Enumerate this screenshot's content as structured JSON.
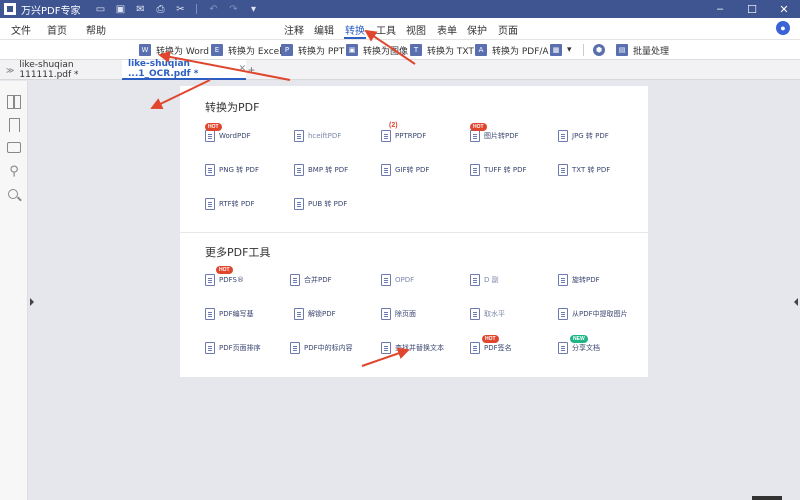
{
  "app": {
    "title": "万兴PDF专家"
  },
  "window_controls": [
    "–",
    "☐",
    "✕"
  ],
  "menu": {
    "left": [
      "文件",
      "首页",
      "帮助"
    ],
    "center": [
      "注释",
      "编辑",
      "转换",
      "工具",
      "视图",
      "表单",
      "保护",
      "页面"
    ],
    "active": "转换"
  },
  "toolbar": {
    "items": [
      {
        "label": "转换为 Word",
        "icon": "W"
      },
      {
        "label": "转换为 Excel",
        "icon": "E"
      },
      {
        "label": "转换为 PPT",
        "icon": "P"
      },
      {
        "label": "转换为图像",
        "icon": "▣"
      },
      {
        "label": "转换为 TXT",
        "icon": "T"
      },
      {
        "label": "转换为 PDF/A",
        "icon": "A"
      }
    ],
    "more_icon": "▦",
    "batch_label": "批量处理"
  },
  "tabs": [
    {
      "label": "like-shuqian 111111.pdf *"
    },
    {
      "label": "like-shuqian ...1_OCR.pdf *",
      "active": true
    }
  ],
  "convert_section": {
    "title": "转换为PDF",
    "items": [
      {
        "label": "WordPDF",
        "badge": "HOT"
      },
      {
        "label": "hceiftPDF"
      },
      {
        "label": "PPTRPDF",
        "badge_text": "(2)"
      },
      {
        "label": "图片转PDF",
        "badge": "HOT"
      },
      {
        "label": "JPG 转 PDF"
      },
      {
        "label": "PNG 转 PDF"
      },
      {
        "label": "BMP 转 PDF"
      },
      {
        "label": "GIF转 PDF"
      },
      {
        "label": "TUFF 转 PDF"
      },
      {
        "label": "TXT 转 PDF"
      },
      {
        "label": "RTF转 PDF"
      },
      {
        "label": "PUB 转 PDF"
      }
    ]
  },
  "tools_section": {
    "title": "更多PDF工具",
    "items": [
      {
        "label": "PDFS®",
        "badge": "HOT"
      },
      {
        "label": "合并PDF"
      },
      {
        "label": "OPDF"
      },
      {
        "label": "D 副"
      },
      {
        "label": "旋转PDF"
      },
      {
        "label": "PDF编写基"
      },
      {
        "label": "解锁PDF"
      },
      {
        "label": "除页面"
      },
      {
        "label": "取水平"
      },
      {
        "label": "从PDF中提取图片"
      },
      {
        "label": "PDF页面排序"
      },
      {
        "label": "PDF中的标内容"
      },
      {
        "label": "查找并替换文本"
      },
      {
        "label": "PDF签名",
        "badge": "HOT"
      },
      {
        "label": "分享文档",
        "badge": "NEW"
      }
    ]
  },
  "colors": {
    "titlebar": "#3f5592",
    "accent": "#2d5fc2",
    "arrow": "#e0462e",
    "workspace": "#e6e7ec"
  }
}
